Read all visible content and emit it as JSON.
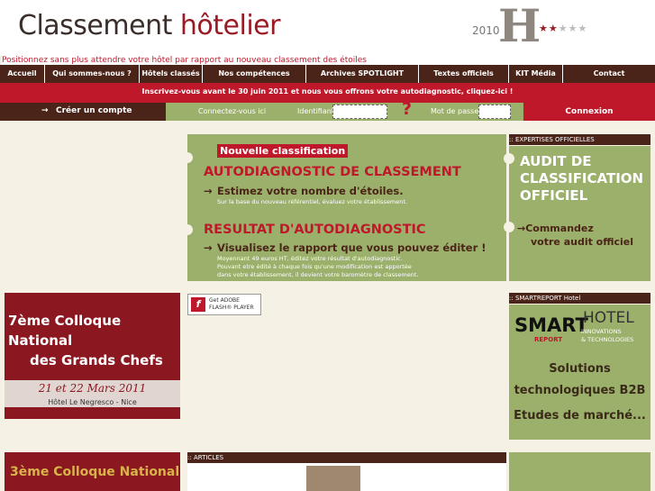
{
  "header": {
    "logo_main": "Classement",
    "logo_accent": "hôtelier",
    "year": "2010",
    "logo_letter": "H",
    "tagline": "Positionnez sans plus attendre votre hôtel par rapport au nouveau classement des étoiles"
  },
  "nav": {
    "items": [
      "Accueil",
      "Qui sommes-nous ?",
      "Hôtels classés",
      "Nos compétences",
      "Archives SPOTLIGHT",
      "Textes officiels",
      "KIT Média",
      "Contact"
    ]
  },
  "promo": "Inscrivez-vous avant le 30 juin 2011 et nous vous offrons votre autodiagnostic, cliquez-ici !",
  "login": {
    "create_label": "Créer un compte",
    "connect_here": "Connectez-vous ici",
    "identifiant_label": "Identifiant :",
    "password_label": "Mot de passe :",
    "connexion_label": "Connexion"
  },
  "banner": {
    "badge": "Nouvelle classification",
    "h1": "AUTODIAGNOSTIC DE CLASSEMENT",
    "s1": "Estimez votre nombre d'étoiles.",
    "t1": "Sur la base du nouveau référentiel, évaluez votre établissement.",
    "h2": "RESULTAT D'AUTODIAGNOSTIC",
    "s2": "Visualisez le rapport que vous pouvez éditer !",
    "t2a": "Moyennant 49 euros HT, éditez votre résultat d'autodiagnostic.",
    "t2b": "Pouvant etre édité à chaque fois qu'une modification est apportée",
    "t2c": "dans votre établissement, il devient votre baromètre de classement."
  },
  "expertises": {
    "header": ":: EXPERTISES OFFICIELLES",
    "title_l1": "AUDIT DE",
    "title_l2": "CLASSIFICATION",
    "title_l3": "OFFICIEL",
    "cta_l1": "Commandez",
    "cta_l2": "votre audit officiel"
  },
  "colloque": {
    "l1": "7ème Colloque National",
    "l2": "des Grands Chefs",
    "date": "21 et 22 Mars 2011",
    "place": "Hôtel Le Negresco - Nice"
  },
  "flash": {
    "get": "Get ADOBE",
    "name": "FLASH® PLAYER"
  },
  "smart": {
    "header": ":: SMARTREPORT Hotel",
    "brand": "SMART",
    "report": "REPORT",
    "hotel": "HOTEL",
    "sub1": "INNOVATIONS",
    "sub2": "& TECHNOLOGIES",
    "l1": "Solutions",
    "l2": "technologiques B2B",
    "l3": "Etudes de marché..."
  },
  "colloque2": {
    "l1": "3ème Colloque National"
  },
  "articles": {
    "header": ":: ARTICLES"
  }
}
